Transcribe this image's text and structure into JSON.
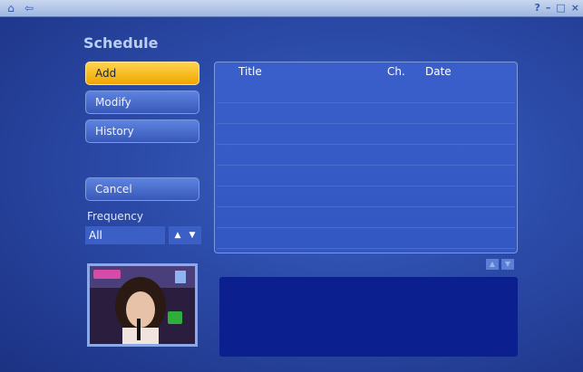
{
  "topbar": {
    "home_icon": "home-icon",
    "back_icon": "back-arrow-icon",
    "right_controls": [
      "?",
      "–",
      "□",
      "×"
    ]
  },
  "page": {
    "title": "Schedule"
  },
  "menu": {
    "buttons": [
      {
        "label": "Add",
        "active": true
      },
      {
        "label": "Modify",
        "active": false
      },
      {
        "label": "History",
        "active": false
      }
    ],
    "cancel_label": "Cancel"
  },
  "frequency": {
    "label": "Frequency",
    "value": "All"
  },
  "list": {
    "columns": {
      "title": "Title",
      "ch": "Ch.",
      "date": "Date"
    },
    "rows": []
  },
  "colors": {
    "background": "#2b4aa8",
    "active_button": "#ffc21a",
    "button": "#4a6fd6",
    "info_panel": "#0c1f8f"
  }
}
